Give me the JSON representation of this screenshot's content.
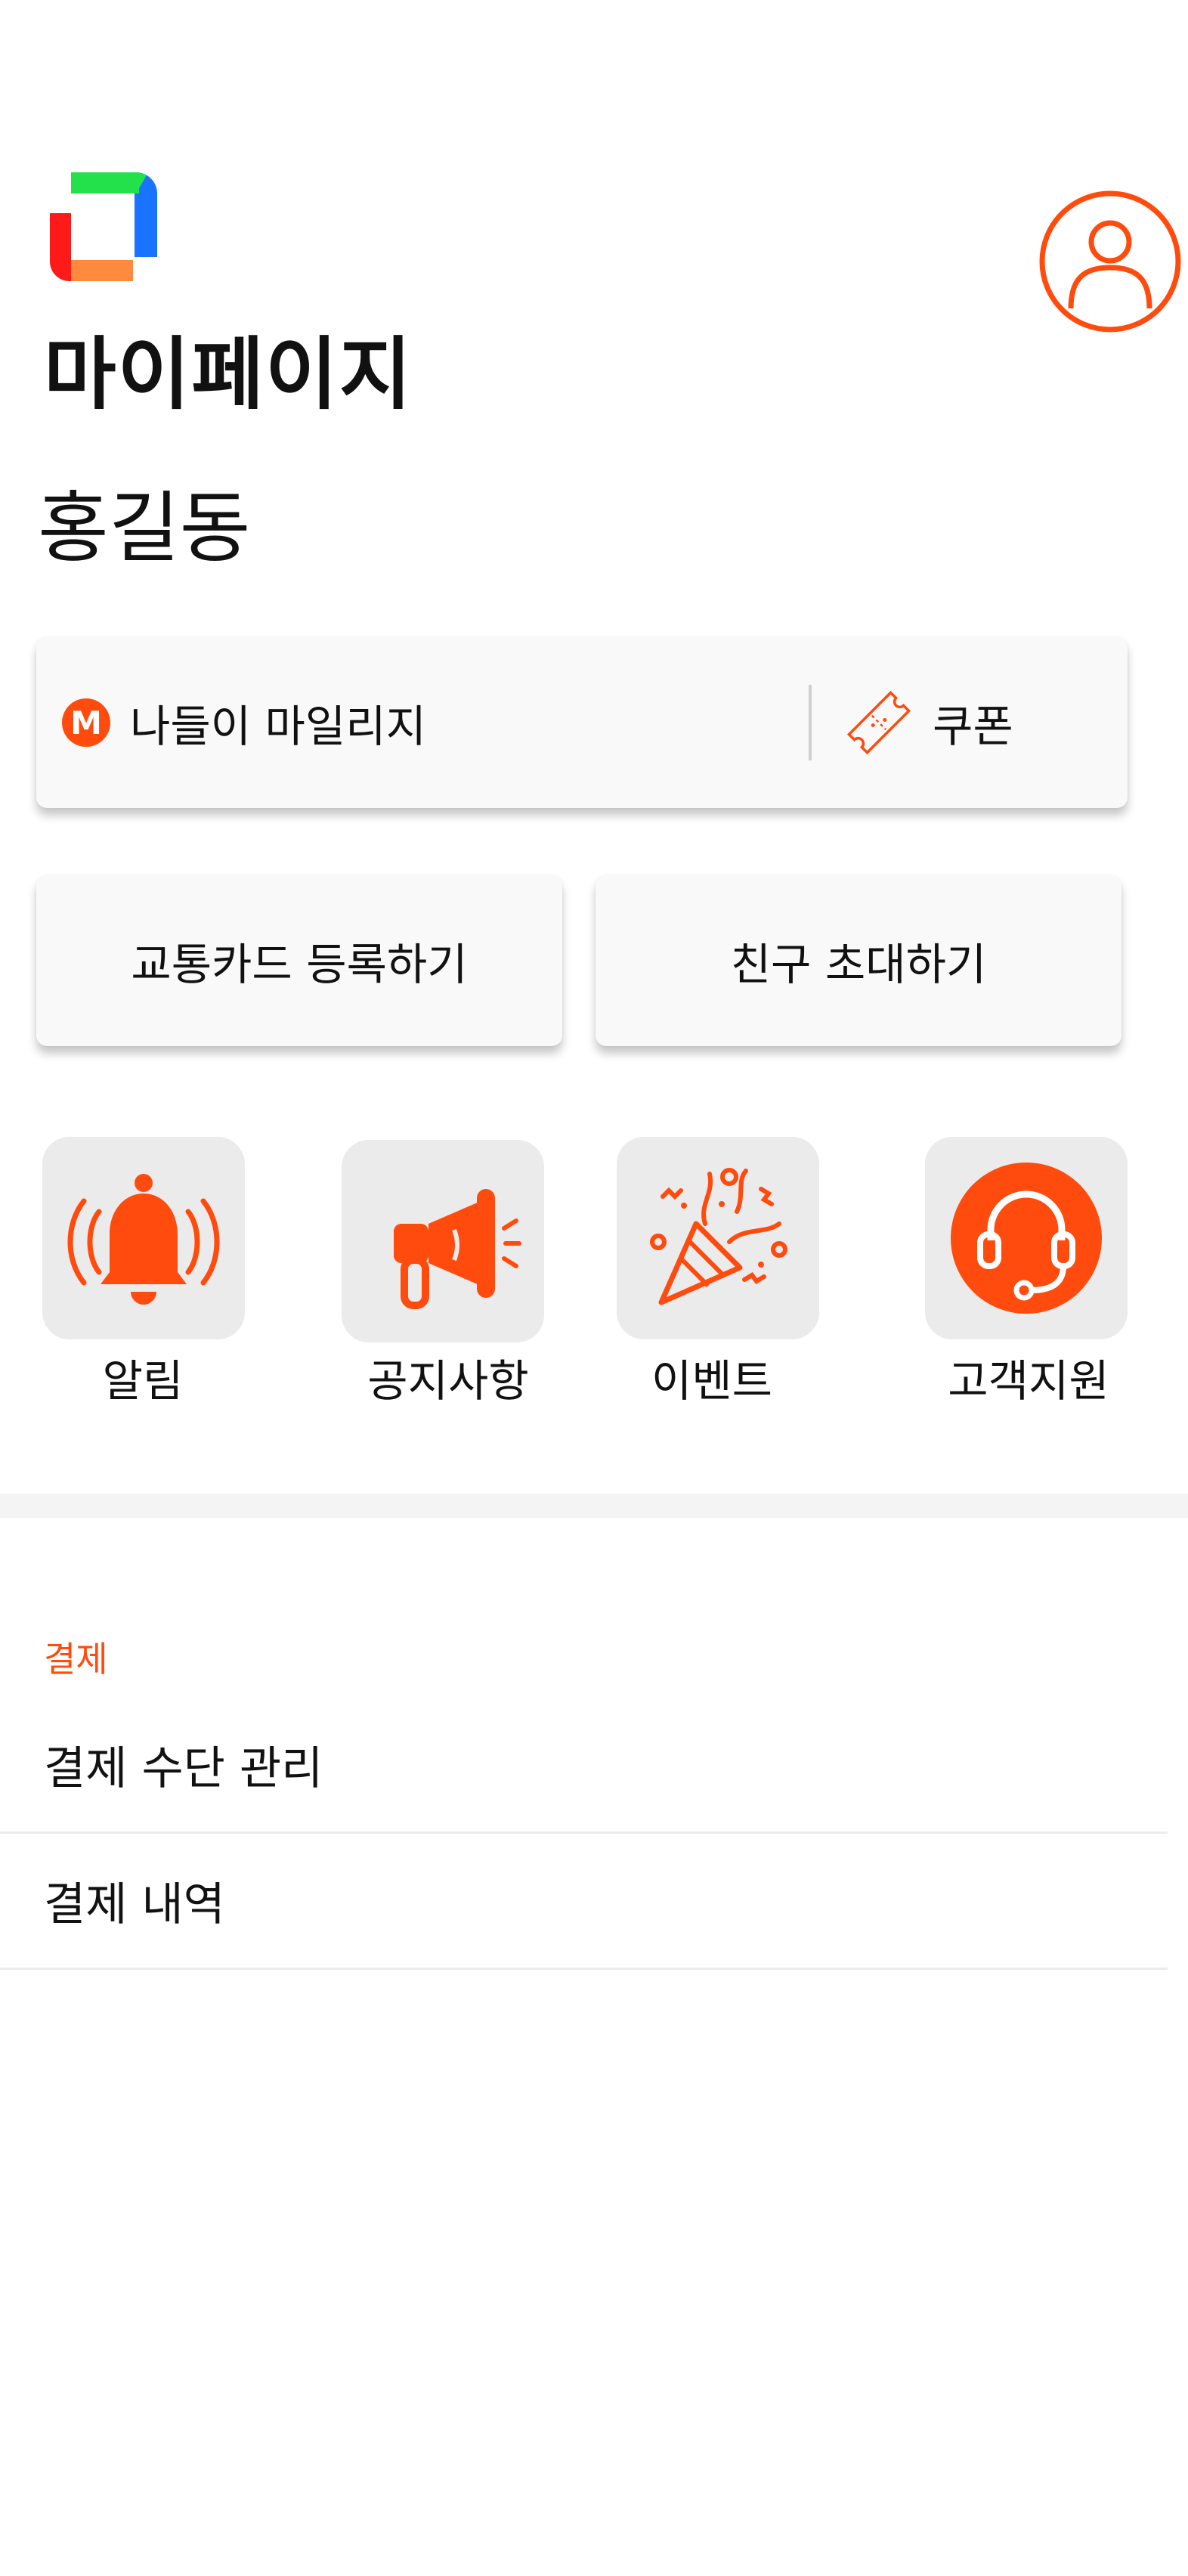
{
  "header": {
    "page_title": "마이페이지",
    "user_name": "홍길동",
    "logo_icon": "app-logo-icon",
    "profile_icon": "user-profile-icon"
  },
  "benefits": {
    "mileage_badge": "M",
    "mileage_label": "나들이 마일리지",
    "coupon_label": "쿠폰",
    "coupon_icon": "ticket-icon"
  },
  "actions": {
    "transit_card_label": "교통카드 등록하기",
    "invite_label": "친구 초대하기"
  },
  "quick_menu": [
    {
      "label": "알림",
      "icon": "bell-icon"
    },
    {
      "label": "공지사항",
      "icon": "megaphone-icon"
    },
    {
      "label": "이벤트",
      "icon": "party-popper-icon"
    },
    {
      "label": "고객지원",
      "icon": "headset-icon"
    }
  ],
  "payment": {
    "section_title": "결제",
    "items": [
      {
        "label": "결제 수단 관리"
      },
      {
        "label": "결제 내역"
      }
    ]
  },
  "colors": {
    "accent": "#ff4b0d",
    "card_background": "#f9f9f9",
    "tile_background": "#ebebeb",
    "logo_green": "#22e14b",
    "logo_blue": "#1a73ff",
    "logo_red": "#ff1a1a",
    "logo_orange": "#ff8a3d"
  }
}
